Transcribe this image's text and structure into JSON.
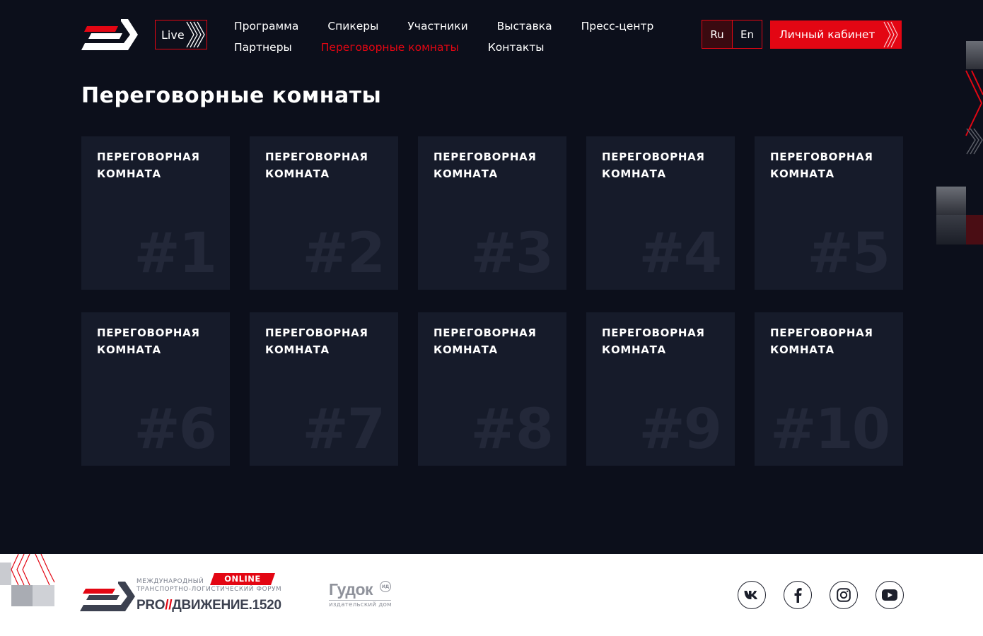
{
  "header": {
    "live_label": "Live",
    "nav": {
      "row1": [
        "Программа",
        "Спикеры",
        "Участники",
        "Выставка",
        "Пресс-центр"
      ],
      "row2": [
        "Партнеры",
        "Переговорные комнаты",
        "Контакты"
      ],
      "active": "Переговорные комнаты"
    },
    "languages": [
      "Ru",
      "En"
    ],
    "active_language": "Ru",
    "cabinet_label": "Личный кабинет"
  },
  "page_title": "Переговорные комнаты",
  "rooms": [
    {
      "label": "Переговорная комната",
      "number": "#1"
    },
    {
      "label": "Переговорная комната",
      "number": "#2"
    },
    {
      "label": "Переговорная комната",
      "number": "#3"
    },
    {
      "label": "Переговорная комната",
      "number": "#4"
    },
    {
      "label": "Переговорная комната",
      "number": "#5"
    },
    {
      "label": "Переговорная комната",
      "number": "#6"
    },
    {
      "label": "Переговорная комната",
      "number": "#7"
    },
    {
      "label": "Переговорная комната",
      "number": "#8"
    },
    {
      "label": "Переговорная комната",
      "number": "#9"
    },
    {
      "label": "Переговорная комната",
      "number": "#10"
    }
  ],
  "footer": {
    "forum_line1": "Международный",
    "forum_line2": "транспортно-логистический форум",
    "online_badge": "ONLINE",
    "forum_name_pre": "PRO",
    "forum_name_sep": "//",
    "forum_name_post": "ДВИЖЕНИЕ.1520",
    "gudok_name": "Гудок",
    "gudok_mark": "ИД",
    "gudok_sub": "издательский дом",
    "socials": [
      "vk-icon",
      "facebook-icon",
      "instagram-icon",
      "youtube-icon"
    ]
  },
  "colors": {
    "background": "#0c0f1b",
    "card": "#161b2a",
    "accent": "#e30613",
    "footer_bg": "#ffffff"
  }
}
